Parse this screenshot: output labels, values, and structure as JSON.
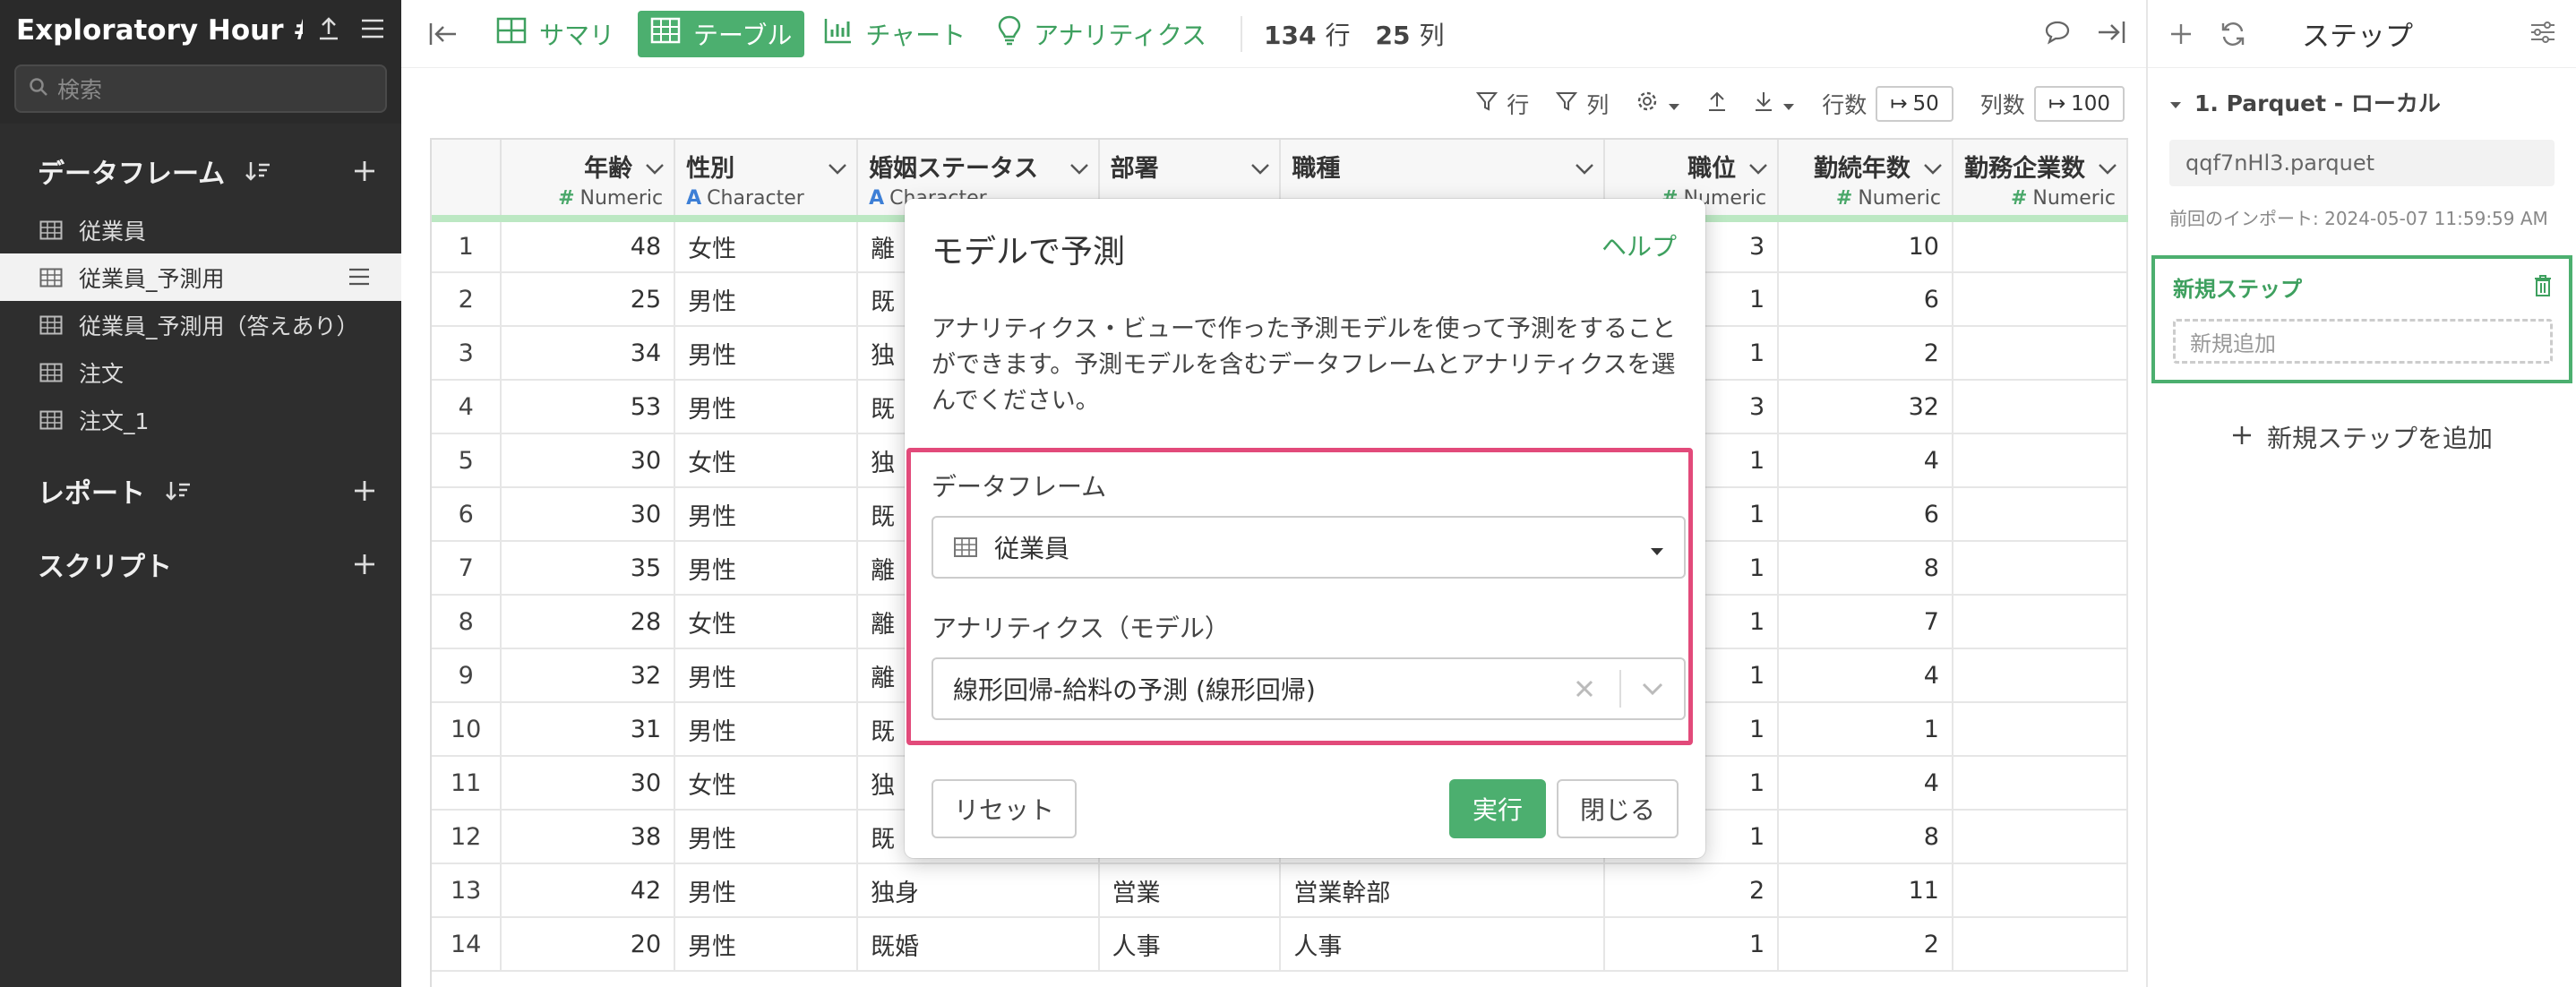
{
  "sidebar": {
    "project_title": "Exploratory Hour #...",
    "search_placeholder": "検索",
    "dataframes_label": "データフレーム",
    "dataframes": [
      {
        "label": "従業員",
        "active": false
      },
      {
        "label": "従業員_予測用",
        "active": true
      },
      {
        "label": "従業員_予測用（答えあり）",
        "active": false
      },
      {
        "label": "注文",
        "active": false
      },
      {
        "label": "注文_1",
        "active": false
      }
    ],
    "reports_label": "レポート",
    "scripts_label": "スクリプト"
  },
  "toolbar": {
    "summary": "サマリ",
    "table": "テーブル",
    "chart": "チャート",
    "analytics": "アナリティクス",
    "rows_count": "134",
    "rows_unit": "行",
    "cols_count": "25",
    "cols_unit": "列"
  },
  "tabletools": {
    "row_filter": "行",
    "col_filter": "列",
    "rows_label": "行数",
    "rows_value": "50",
    "cols_label": "列数",
    "cols_value": "100"
  },
  "table": {
    "columns": [
      {
        "name": "年齢",
        "type": "Numeric",
        "numeric": true
      },
      {
        "name": "性別",
        "type": "Character",
        "numeric": false
      },
      {
        "name": "婚姻ステータス",
        "type": "Character",
        "numeric": false
      },
      {
        "name": "部署",
        "type": "",
        "numeric": false
      },
      {
        "name": "職種",
        "type": "",
        "numeric": false
      },
      {
        "name": "職位",
        "type": "Numeric",
        "numeric": true
      },
      {
        "name": "勤続年数",
        "type": "Numeric",
        "numeric": true
      },
      {
        "name": "勤務企業数",
        "type": "Numeric",
        "numeric": true
      }
    ],
    "rows": [
      [
        "1",
        "48",
        "女性",
        "離",
        "",
        "",
        "3",
        "10",
        ""
      ],
      [
        "2",
        "25",
        "男性",
        "既",
        "",
        "",
        "1",
        "6",
        ""
      ],
      [
        "3",
        "34",
        "男性",
        "独",
        "",
        "",
        "1",
        "2",
        ""
      ],
      [
        "4",
        "53",
        "男性",
        "既",
        "",
        "",
        "3",
        "32",
        ""
      ],
      [
        "5",
        "30",
        "女性",
        "独",
        "",
        "",
        "1",
        "4",
        ""
      ],
      [
        "6",
        "30",
        "男性",
        "既",
        "",
        "",
        "1",
        "6",
        ""
      ],
      [
        "7",
        "35",
        "男性",
        "離",
        "",
        "",
        "1",
        "8",
        ""
      ],
      [
        "8",
        "28",
        "女性",
        "離",
        "",
        "",
        "1",
        "7",
        ""
      ],
      [
        "9",
        "32",
        "男性",
        "離",
        "",
        "",
        "1",
        "4",
        ""
      ],
      [
        "10",
        "31",
        "男性",
        "既",
        "",
        "",
        "1",
        "1",
        ""
      ],
      [
        "11",
        "30",
        "女性",
        "独",
        "",
        "",
        "1",
        "4",
        ""
      ],
      [
        "12",
        "38",
        "男性",
        "既",
        "",
        "",
        "1",
        "8",
        ""
      ],
      [
        "13",
        "42",
        "男性",
        "独身",
        "営業",
        "営業幹部",
        "2",
        "11",
        ""
      ],
      [
        "14",
        "20",
        "男性",
        "既婚",
        "人事",
        "人事",
        "1",
        "2",
        ""
      ]
    ]
  },
  "steps": {
    "title": "ステップ",
    "step1_name": "1. Parquet - ローカル",
    "step1_file": "qqf7nHl3.parquet",
    "step1_meta": "前回のインポート: 2024-05-07 11:59:59 AM",
    "new_step_title": "新規ステップ",
    "new_step_add": "新規追加",
    "add_step_label": "新規ステップを追加"
  },
  "modal": {
    "title": "モデルで予測",
    "help": "ヘルプ",
    "description": "アナリティクス・ビューで作った予測モデルを使って予測をすることができます。予測モデルを含むデータフレームとアナリティクスを選んでください。",
    "dataframe_label": "データフレーム",
    "dataframe_value": "従業員",
    "analytics_label": "アナリティクス（モデル）",
    "analytics_value": "線形回帰-給料の予測 (線形回帰)",
    "reset": "リセット",
    "run": "実行",
    "close": "閉じる"
  },
  "colors": {
    "accent_green": "#4caf6f",
    "highlight_pink": "#e24a7a",
    "sidebar_bg": "#2e2e2e"
  }
}
